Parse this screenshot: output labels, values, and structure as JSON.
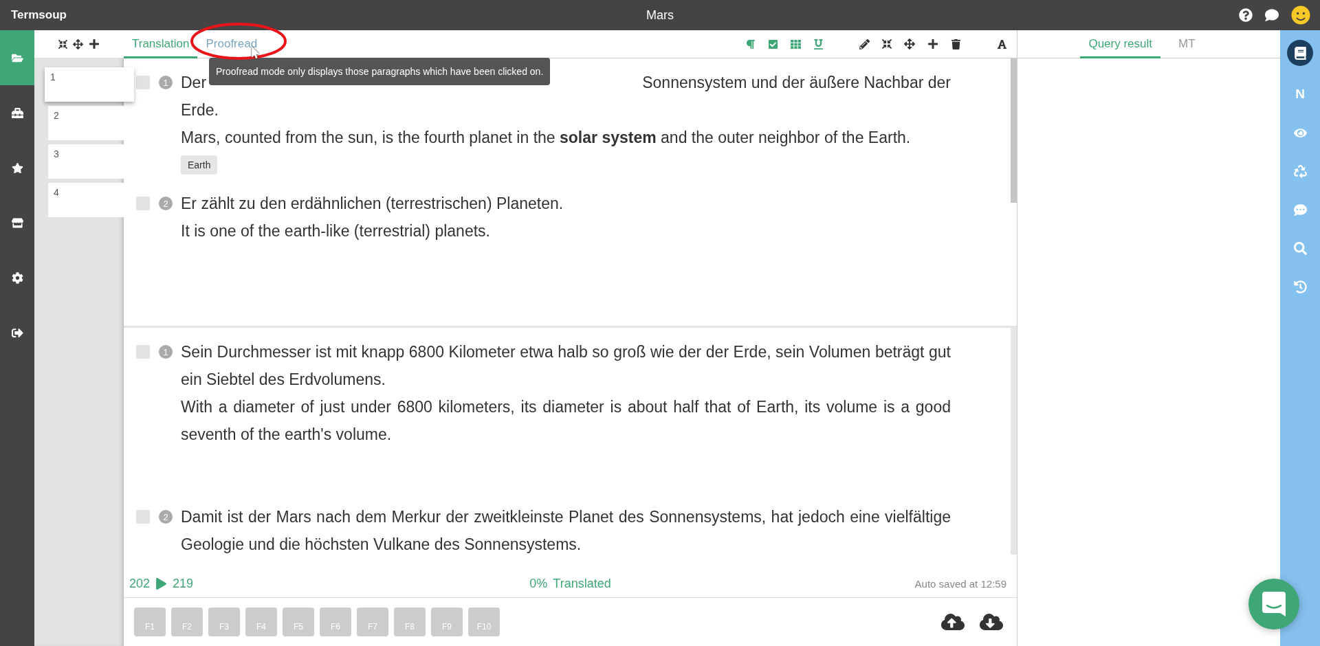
{
  "app": {
    "title": "Termsoup",
    "document_title": "Mars"
  },
  "nav": [
    {
      "selected": true
    },
    {
      "selected": false
    },
    {
      "selected": false
    },
    {
      "selected": false
    },
    {
      "selected": false
    },
    {
      "selected": false
    }
  ],
  "pages": [
    {
      "label": "1",
      "selected": true
    },
    {
      "label": "2",
      "selected": false
    },
    {
      "label": "3",
      "selected": false
    },
    {
      "label": "4",
      "selected": false
    }
  ],
  "editor": {
    "tabs": [
      {
        "label": "Translation",
        "selected": true
      },
      {
        "label": "Proofread",
        "selected": false
      }
    ],
    "tooltip": "Proofread mode only displays those paragraphs which have been clicked on.",
    "toggles": [
      {
        "on": true
      },
      {
        "on": true
      },
      {
        "on": true
      },
      {
        "on": true
      }
    ],
    "sections": [
      {
        "segments": [
          {
            "number": "1",
            "checked": false,
            "source_lines": [
              [
                "Der",
                "Sonnensystem und der äußere Nachbar der"
              ],
              [
                "Erde."
              ]
            ],
            "translation": "Mars, counted from the sun, is the fourth planet in the **solar system** and the outer neighbor of the Earth.",
            "terms": [
              "Earth"
            ]
          },
          {
            "number": "2",
            "checked": false,
            "source_lines": [
              [
                "Er zählt zu den erdähnlichen (terrestrischen) Planeten."
              ]
            ],
            "translation": "It is one of the earth-like (terrestrial) planets."
          }
        ]
      },
      {
        "segments": [
          {
            "number": "1",
            "checked": false,
            "source_lines": [
              [
                "Sein Durchmesser ist mit knapp 6800 Kilometer etwa halb so groß wie der der Erde, sein Volumen beträgt gut ein Siebtel des Erdvolumens."
              ]
            ],
            "translation": "With a diameter of just under 6800 kilometers, its diameter is about half that of Earth, its volume is a good seventh of the earth's volume."
          },
          {
            "number": "2",
            "checked": false,
            "source_lines": [
              [
                "Damit ist der Mars nach dem Merkur der zweitkleinste Planet des Sonnensystems, hat jedoch eine vielfältige Geologie und die höchsten Vulkane des Sonnensystems."
              ]
            ]
          }
        ]
      }
    ],
    "status": {
      "from": "202",
      "to": "219",
      "progress": "0%",
      "progress_label": "Translated",
      "saved": "Auto saved at 12:59"
    },
    "function_keys": [
      "F1",
      "F2",
      "F3",
      "F4",
      "F5",
      "F6",
      "F7",
      "F8",
      "F9",
      "F10"
    ]
  },
  "side_panel": {
    "tabs": [
      {
        "label": "Query result",
        "selected": true
      },
      {
        "label": "MT",
        "selected": false
      }
    ]
  },
  "rail": [
    {
      "selected": true
    },
    {
      "label": "N",
      "selected": false
    },
    {
      "selected": false
    },
    {
      "selected": false
    },
    {
      "selected": false
    },
    {
      "selected": false
    },
    {
      "selected": false
    }
  ]
}
